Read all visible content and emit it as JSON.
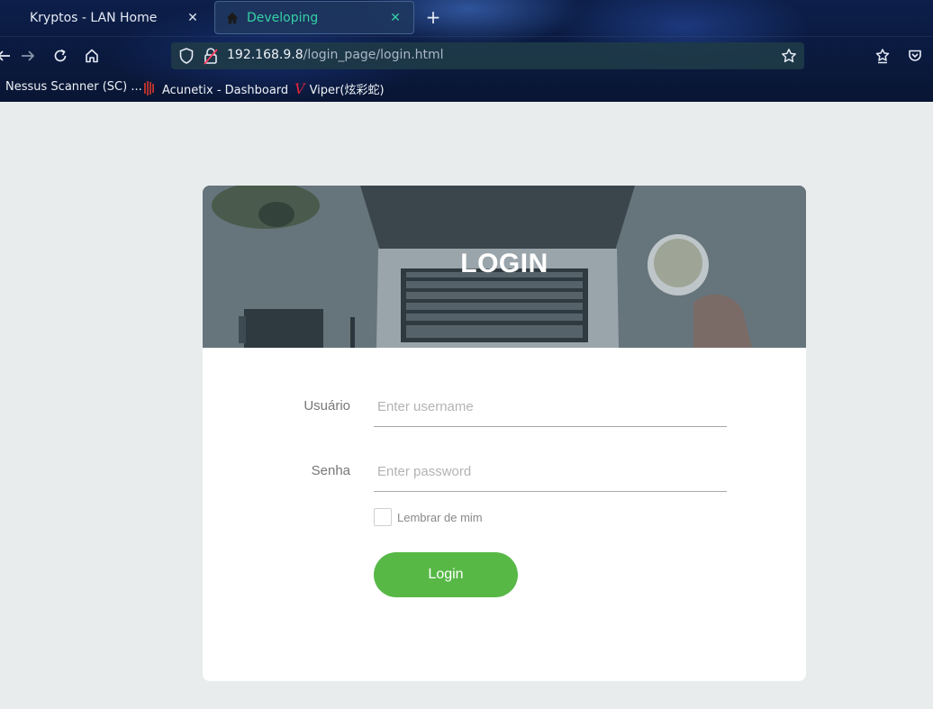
{
  "browser": {
    "tabs": [
      {
        "title": "Kryptos - LAN Home",
        "active": false
      },
      {
        "title": "Developing",
        "active": true
      }
    ],
    "url": {
      "host": "192.168.9.8",
      "path": "/login_page/login.html"
    },
    "bookmarks": [
      {
        "label": "Nessus Scanner (SC) ..."
      },
      {
        "label": "Acunetix - Dashboard"
      },
      {
        "label": "Viper(炫彩蛇)"
      }
    ],
    "icons": {
      "back": "arrow-left-icon",
      "forward": "arrow-right-icon",
      "reload": "reload-icon",
      "home": "home-icon",
      "shield": "shield-icon",
      "lock": "insecure-lock-icon",
      "bookmark": "star-icon",
      "extensions": "extensions-icon",
      "pocket": "pocket-icon"
    }
  },
  "login": {
    "title": "LOGIN",
    "username_label": "Usuário",
    "username_placeholder": "Enter username",
    "password_label": "Senha",
    "password_placeholder": "Enter password",
    "remember_label": "Lembrar de mim",
    "submit_label": "Login"
  },
  "colors": {
    "accent_green": "#57b846",
    "active_tab_text": "#35d0a5",
    "page_background": "#e9eced"
  }
}
